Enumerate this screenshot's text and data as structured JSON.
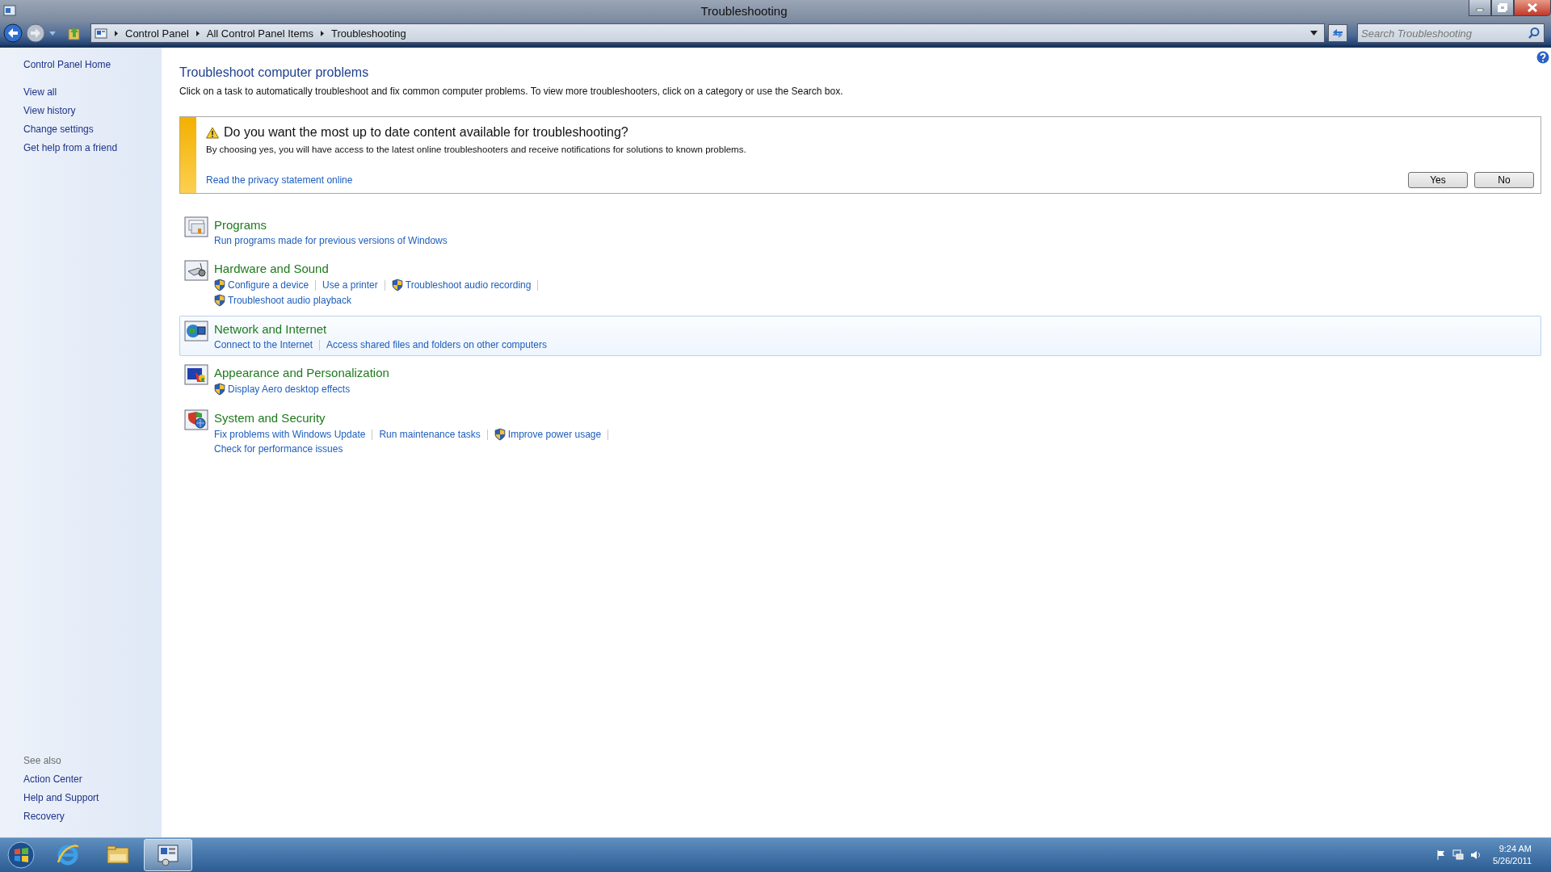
{
  "window": {
    "title": "Troubleshooting"
  },
  "address_bar": {
    "breadcrumbs": [
      "Control Panel",
      "All Control Panel Items",
      "Troubleshooting"
    ]
  },
  "search": {
    "placeholder": "Search Troubleshooting"
  },
  "sidebar": {
    "items": [
      "Control Panel Home",
      "View all",
      "View history",
      "Change settings",
      "Get help from a friend"
    ],
    "see_also_heading": "See also",
    "see_also": [
      "Action Center",
      "Help and Support",
      "Recovery"
    ]
  },
  "page": {
    "title": "Troubleshoot computer problems",
    "description": "Click on a task to automatically troubleshoot and fix common computer problems. To view more troubleshooters, click on a category or use the Search box."
  },
  "banner": {
    "heading": "Do you want the most up to date content available for troubleshooting?",
    "text": "By choosing yes, you will have access to the latest online troubleshooters and receive notifications for solutions to known problems.",
    "link": "Read the privacy statement online",
    "buttons": [
      "Yes",
      "No"
    ]
  },
  "categories": [
    {
      "kind": "programs",
      "title": "Programs",
      "hovered": false,
      "rows": [
        [
          {
            "label": "Run programs made for previous versions of Windows",
            "shield": false
          }
        ]
      ]
    },
    {
      "kind": "hardware",
      "title": "Hardware and Sound",
      "hovered": false,
      "rows": [
        [
          {
            "label": "Configure a device",
            "shield": true
          },
          {
            "label": "Use a printer",
            "shield": false
          },
          {
            "label": "Troubleshoot audio recording",
            "shield": true
          }
        ],
        [
          {
            "label": "Troubleshoot audio playback",
            "shield": true
          }
        ]
      ]
    },
    {
      "kind": "network",
      "title": "Network and Internet",
      "hovered": true,
      "rows": [
        [
          {
            "label": "Connect to the Internet",
            "shield": false
          },
          {
            "label": "Access shared files and folders on other computers",
            "shield": false
          }
        ]
      ]
    },
    {
      "kind": "appearance",
      "title": "Appearance and Personalization",
      "hovered": false,
      "rows": [
        [
          {
            "label": "Display Aero desktop effects",
            "shield": true
          }
        ]
      ]
    },
    {
      "kind": "security",
      "title": "System and Security",
      "hovered": false,
      "rows": [
        [
          {
            "label": "Fix problems with Windows Update",
            "shield": false
          },
          {
            "label": "Run maintenance tasks",
            "shield": false
          },
          {
            "label": "Improve power usage",
            "shield": true
          }
        ],
        [
          {
            "label": "Check for performance issues",
            "shield": false
          }
        ]
      ]
    }
  ],
  "taskbar": {
    "apps": [
      {
        "kind": "ie",
        "selected": false
      },
      {
        "kind": "explorer",
        "selected": false
      },
      {
        "kind": "control-panel",
        "selected": true
      }
    ],
    "time": "9:24 AM",
    "date": "5/26/2011"
  }
}
